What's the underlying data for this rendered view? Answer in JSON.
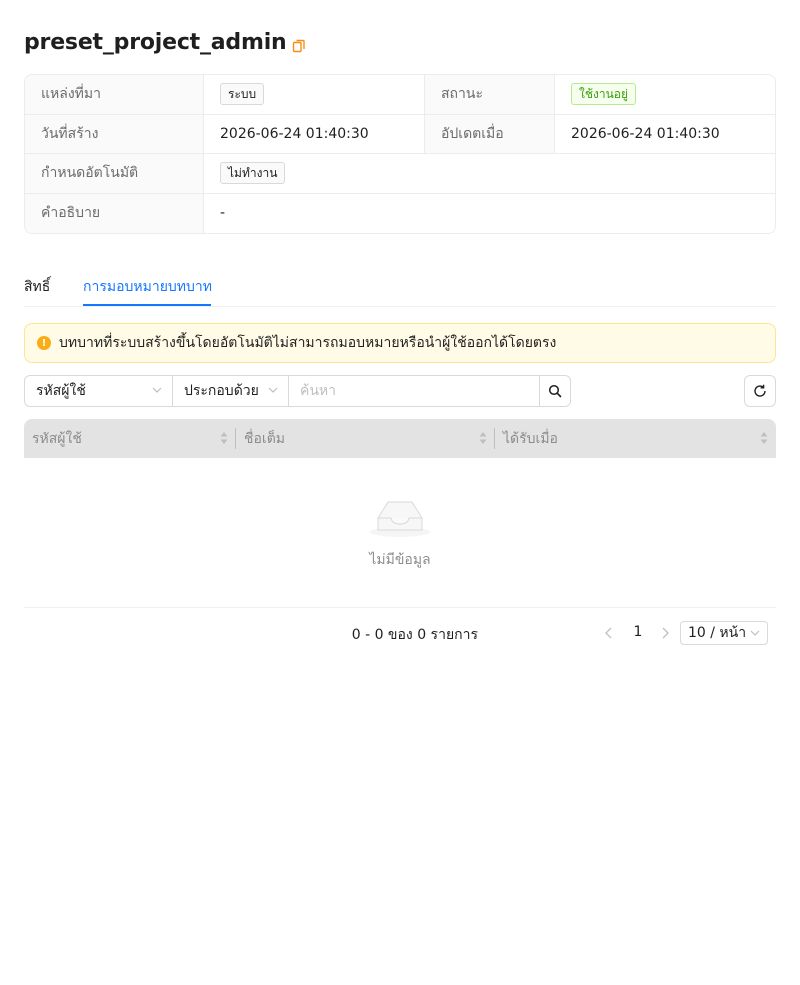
{
  "header": {
    "title": "preset_project_admin"
  },
  "details": {
    "source_label": "แหล่งที่มา",
    "source_value": "ระบบ",
    "status_label": "สถานะ",
    "status_value": "ใช้งานอยู่",
    "created_label": "วันที่สร้าง",
    "created_value": "2026-06-24 01:40:30",
    "updated_label": "อัปเดตเมื่อ",
    "updated_value": "2026-06-24 01:40:30",
    "auto_label": "กำหนดอัตโนมัติ",
    "auto_value": "ไม่ทำงาน",
    "description_label": "คำอธิบาย",
    "description_value": "-"
  },
  "tabs": [
    {
      "label": "สิทธิ์"
    },
    {
      "label": "การมอบหมายบทบาท"
    }
  ],
  "alert": {
    "text": "บทบาทที่ระบบสร้างขึ้นโดยอัตโนมัติไม่สามารถมอบหมายหรือนำผู้ใช้ออกได้โดยตรง"
  },
  "filter": {
    "field_value": "รหัสผู้ใช้",
    "operator_value": "ประกอบด้วย",
    "search_placeholder": "ค้นหา"
  },
  "table": {
    "columns": [
      "รหัสผู้ใช้",
      "ชื่อเต็ม",
      "ได้รับเมื่อ"
    ],
    "rows": [],
    "empty_text": "ไม่มีข้อมูล"
  },
  "pagination": {
    "total_text": "0 - 0 ของ 0 รายการ",
    "current_page": "1",
    "page_size": "10 / หน้า"
  },
  "colors": {
    "accent": "#1677ff",
    "warning": "#faad14",
    "success": "#389e0d",
    "copy_icon": "#fa8c16"
  }
}
